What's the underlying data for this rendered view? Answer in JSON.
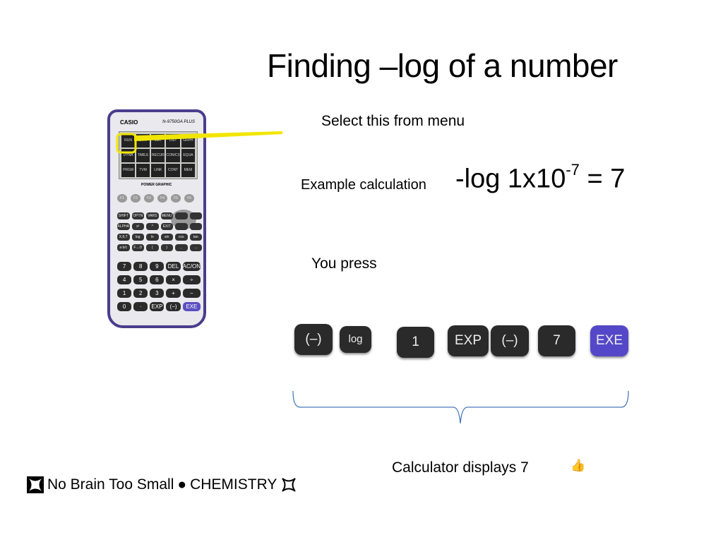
{
  "title": "Finding –log of a number",
  "select_note": "Select this from menu",
  "example": {
    "label": "Example calculation",
    "expr_base": "-log 1x10",
    "expr_exp": "-7",
    "expr_result": " = 7"
  },
  "you_press": "You press",
  "key_sequence": [
    "(–)",
    "log",
    "1",
    "EXP",
    "(–)",
    "7",
    "EXE"
  ],
  "displays": "Calculator displays  7",
  "thumb_icon": "thumbs-up-icon",
  "footer": {
    "text": "No Brain Too Small",
    "bullet": "●",
    "subject": "CHEMISTRY"
  },
  "calculator": {
    "brand": "CASIO",
    "model": "fx-9750GA PLUS",
    "label": "POWER GRAPHIC",
    "menu_icons": [
      "RUN",
      "STAT",
      "MAT",
      "LIST",
      "GRPH",
      "DYNA",
      "TABLE",
      "RECUR",
      "CONICS",
      "EQUA",
      "PRGM",
      "TVM",
      "LINK",
      "CONT",
      "MEM"
    ],
    "fkeys": [
      "F1",
      "F2",
      "F3",
      "F4",
      "F5",
      "F6"
    ],
    "func_keys": [
      "SHIFT",
      "OPTN",
      "VARS",
      "MENU",
      "",
      "",
      "ALPHA",
      "x²",
      "^",
      "EXIT",
      "",
      "",
      "X,θ,T",
      "log",
      "ln",
      "sin",
      "cos",
      "tan",
      "a b/c",
      "F↔D",
      "(",
      ")",
      ",",
      "→"
    ],
    "num_keys": [
      "7",
      "8",
      "9",
      "DEL",
      "AC/ON",
      "4",
      "5",
      "6",
      "×",
      "÷",
      "1",
      "2",
      "3",
      "+",
      "−",
      "0",
      "·",
      "EXP",
      "(−)",
      "EXE"
    ]
  },
  "colors": {
    "highlight": "#f2e600",
    "exe_key": "#5548c8",
    "brace": "#4a7ab8"
  }
}
